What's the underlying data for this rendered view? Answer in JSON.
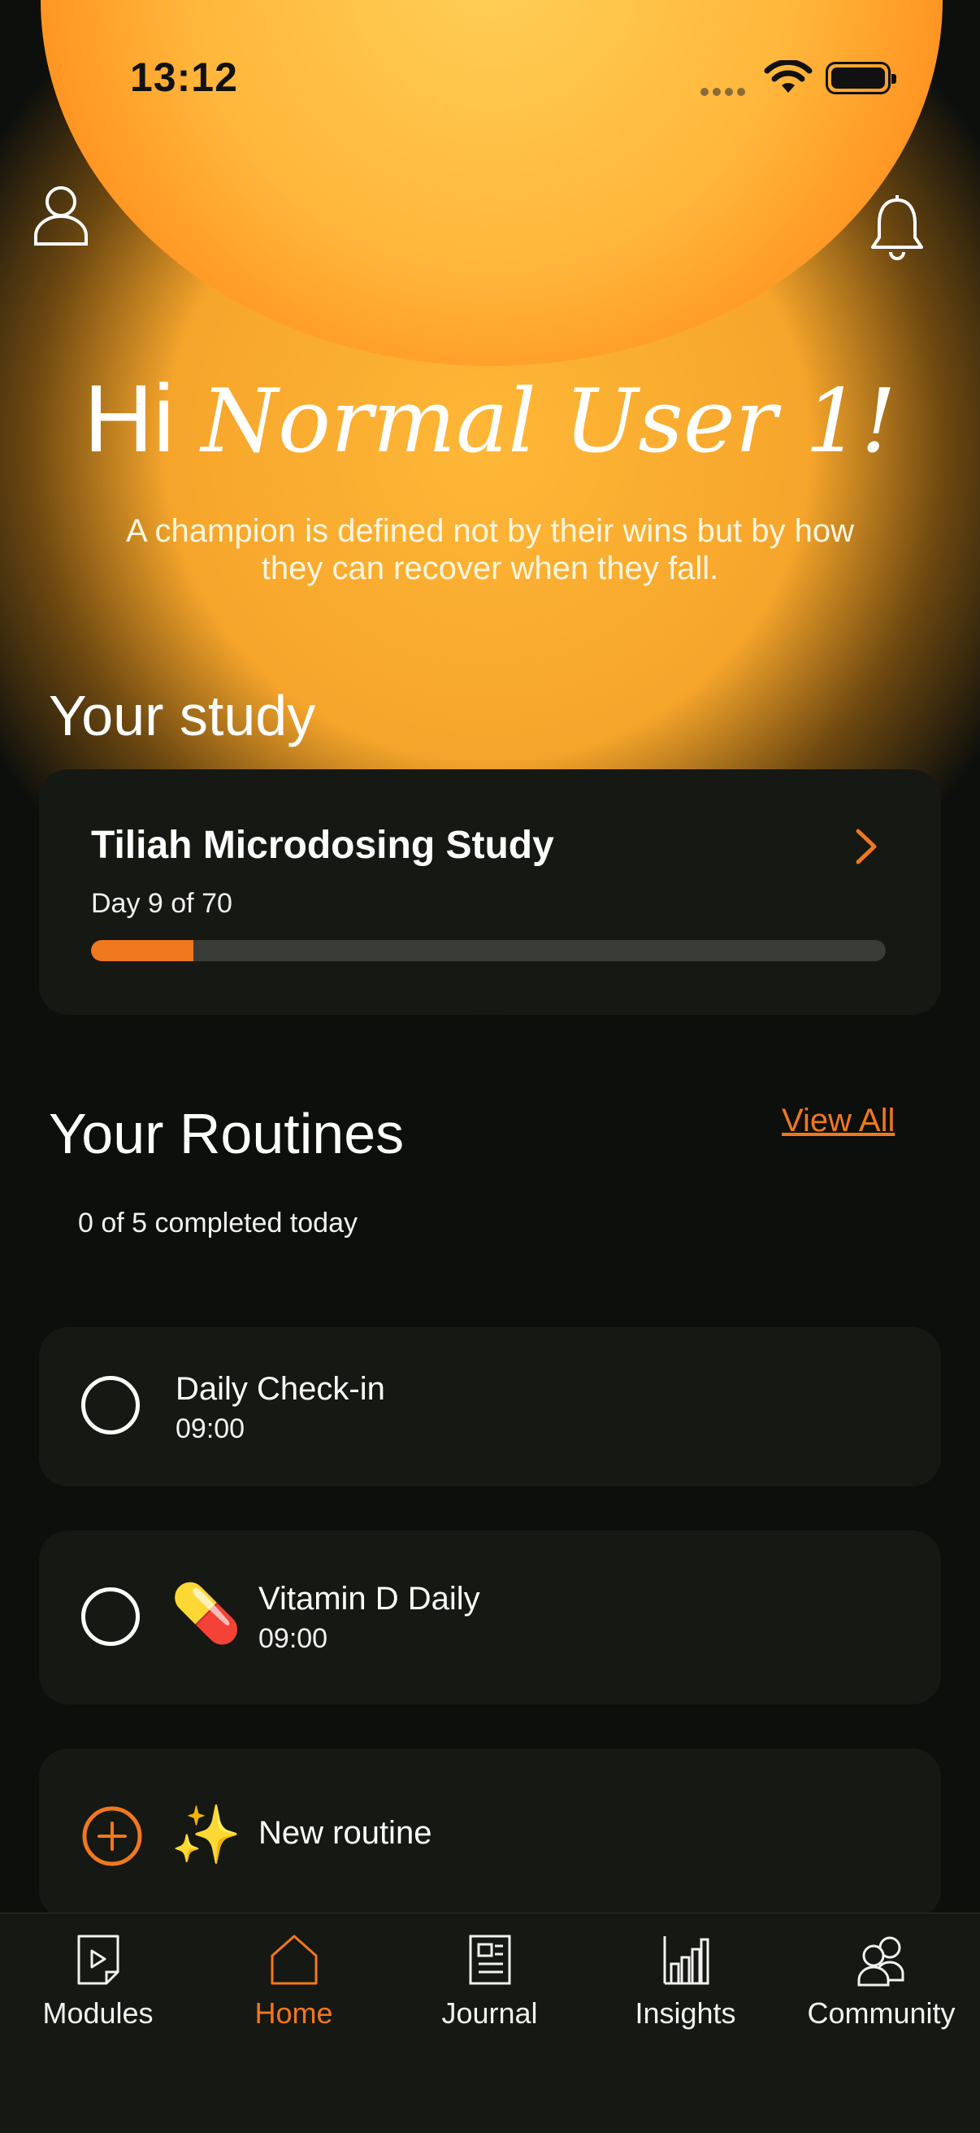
{
  "status_bar": {
    "time": "13:12"
  },
  "header": {
    "greeting_prefix": "Hi",
    "greeting_name": "Normal User 1!",
    "quote": "A champion is defined not by their wins but by how they can recover when they fall."
  },
  "study": {
    "section_title": "Your study",
    "name": "Tiliah Microdosing Study",
    "day_text": "Day 9 of 70",
    "progress_fraction": 0.129
  },
  "routines": {
    "section_title": "Your Routines",
    "view_all_label": "View All",
    "completed_text": "0 of 5 completed today",
    "items": [
      {
        "title": "Daily Check-in",
        "time": "09:00"
      },
      {
        "title": "Vitamin D Daily",
        "time": "09:00",
        "emoji": "💊"
      }
    ],
    "new_routine": {
      "label": "New routine",
      "emoji": "✨"
    }
  },
  "tabbar": {
    "items": [
      {
        "label": "Modules",
        "icon": "modules-icon"
      },
      {
        "label": "Home",
        "icon": "home-icon"
      },
      {
        "label": "Journal",
        "icon": "journal-icon"
      },
      {
        "label": "Insights",
        "icon": "insights-icon"
      },
      {
        "label": "Community",
        "icon": "community-icon"
      }
    ],
    "active": "Home"
  },
  "colors": {
    "accent": "#f0781e",
    "card": "#161813",
    "background": "#0d0f0c",
    "glow": "#ffb737"
  }
}
